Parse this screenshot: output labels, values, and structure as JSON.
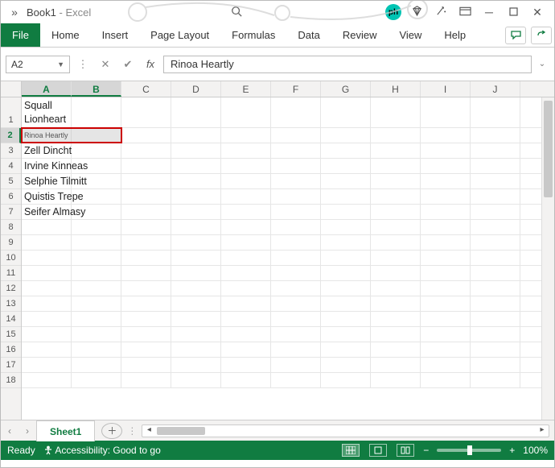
{
  "titlebar": {
    "filename": "Book1",
    "app": "Excel",
    "badge": "ph"
  },
  "tabs": {
    "file": "File",
    "items": [
      "Home",
      "Insert",
      "Page Layout",
      "Formulas",
      "Data",
      "Review",
      "View",
      "Help"
    ]
  },
  "formula": {
    "namebox": "A2",
    "fx": "fx",
    "value": "Rinoa Heartly"
  },
  "columns": [
    "A",
    "B",
    "C",
    "D",
    "E",
    "F",
    "G",
    "H",
    "I",
    "J"
  ],
  "selected_col_indexes": [
    0,
    1
  ],
  "rows": [
    {
      "n": "1",
      "tall": true
    },
    {
      "n": "2",
      "selected": true
    },
    {
      "n": "3"
    },
    {
      "n": "4"
    },
    {
      "n": "5"
    },
    {
      "n": "6"
    },
    {
      "n": "7"
    },
    {
      "n": "8"
    },
    {
      "n": "9"
    },
    {
      "n": "10"
    },
    {
      "n": "11"
    },
    {
      "n": "12"
    },
    {
      "n": "13"
    },
    {
      "n": "14"
    },
    {
      "n": "15"
    },
    {
      "n": "16"
    },
    {
      "n": "17"
    },
    {
      "n": "18"
    }
  ],
  "cells": {
    "A1": "Squall Lionheart",
    "A2": "Rinoa Heartly",
    "A3": "Zell Dincht",
    "A4": "Irvine Kinneas",
    "A5": "Selphie Tilmitt",
    "A6": "Quistis Trepe",
    "A7": "Seifer Almasy"
  },
  "selection": {
    "row": "2",
    "cols": [
      "A",
      "B"
    ],
    "shrink_to_fit": true
  },
  "sheet": {
    "active": "Sheet1"
  },
  "status": {
    "ready": "Ready",
    "accessibility": "Accessibility: Good to go",
    "zoom": "100%"
  }
}
